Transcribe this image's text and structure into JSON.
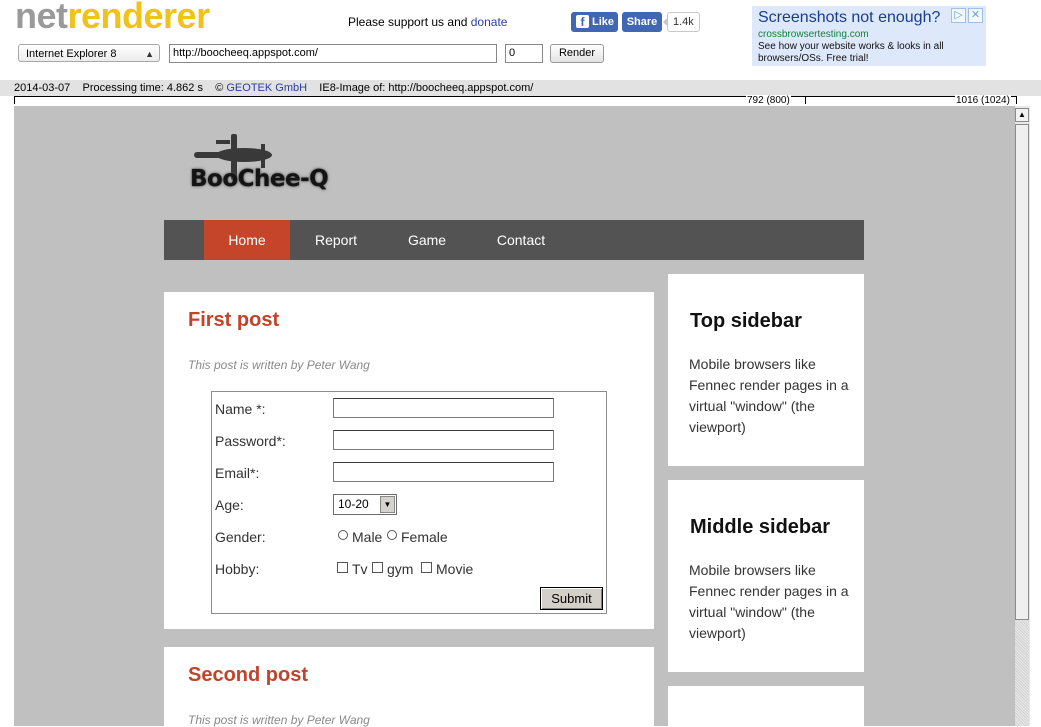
{
  "header": {
    "logo_part1": "net",
    "logo_part2": "renderer",
    "support_text": "Please support us and ",
    "donate_link": "donate",
    "fb_like": "Like",
    "fb_share": "Share",
    "fb_count": "1.4k",
    "browser_select": "Internet Explorer 8",
    "url_value": "http://boocheeq.appspot.com/",
    "delay_value": "0",
    "render_button": "Render"
  },
  "ad": {
    "title": "Screenshots not enough?",
    "url": "crossbrowsertesting.com",
    "description": "See how your website works & looks in all browsers/OSs. Free trial!"
  },
  "info": {
    "date": "2014-03-07",
    "processing": "Processing time: 4.862 s",
    "copyright": "© ",
    "company": "GEOTEK GmbH",
    "image_of": "IE8-Image of: http://boocheeq.appspot.com/",
    "ruler_label_1": "792 (800)",
    "ruler_label_2": "1016 (1024)"
  },
  "site": {
    "logo_text": "BooChee-Q",
    "nav": [
      "Home",
      "Report",
      "Game",
      "Contact"
    ],
    "active_nav": "Home",
    "posts": [
      {
        "title": "First post",
        "byline": "This post is written by Peter Wang"
      },
      {
        "title": "Second post",
        "byline": "This post is written by Peter Wang"
      }
    ],
    "form": {
      "name_label": "Name *:",
      "password_label": "Password*:",
      "email_label": "Email*:",
      "age_label": "Age:",
      "age_value": "10-20",
      "gender_label": "Gender:",
      "gender_options": [
        "Male",
        "Female"
      ],
      "hobby_label": "Hobby:",
      "hobby_options": [
        "Tv",
        "gym",
        "Movie"
      ],
      "submit": "Submit"
    },
    "sidebars": [
      {
        "title": "Top sidebar",
        "text": "Mobile browsers like Fennec render pages in a virtual \"window\" (the viewport)"
      },
      {
        "title": "Middle sidebar",
        "text": "Mobile browsers like Fennec render pages in a virtual \"window\" (the viewport)"
      }
    ]
  },
  "colors": {
    "accent": "#c5452a",
    "nav_bg": "#535353",
    "page_bg": "#c0c0c0",
    "logo_grey": "#9a9a9a",
    "logo_yellow": "#f0c21a"
  }
}
